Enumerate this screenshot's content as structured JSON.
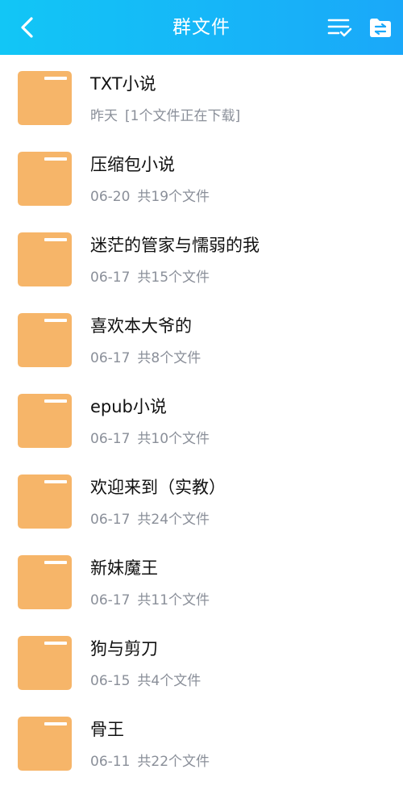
{
  "header": {
    "title": "群文件",
    "back_icon": "chevron-left-icon",
    "multi_select_icon": "list-check-icon",
    "transfer_icon": "folder-transfer-icon",
    "background": "#1aa8f9"
  },
  "folder_color": "#f6b569",
  "files": [
    {
      "name": "TXT小说",
      "date": "昨天",
      "info": "[1个文件正在下载]"
    },
    {
      "name": "压缩包小说",
      "date": "06-20",
      "info": "共19个文件"
    },
    {
      "name": "迷茫的管家与懦弱的我",
      "date": "06-17",
      "info": "共15个文件"
    },
    {
      "name": "喜欢本大爷的",
      "date": "06-17",
      "info": "共8个文件"
    },
    {
      "name": "epub小说",
      "date": "06-17",
      "info": "共10个文件"
    },
    {
      "name": "欢迎来到（实教）",
      "date": "06-17",
      "info": "共24个文件"
    },
    {
      "name": "新妹魔王",
      "date": "06-17",
      "info": "共11个文件"
    },
    {
      "name": "狗与剪刀",
      "date": "06-15",
      "info": "共4个文件"
    },
    {
      "name": "骨王",
      "date": "06-11",
      "info": "共22个文件"
    }
  ]
}
